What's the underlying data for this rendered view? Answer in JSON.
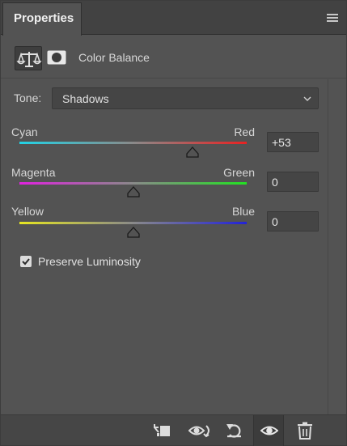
{
  "panel": {
    "tab_label": "Properties",
    "title": "Color Balance"
  },
  "tone": {
    "label": "Tone:",
    "value": "Shadows"
  },
  "sliders": [
    {
      "left_label": "Cyan",
      "right_label": "Red",
      "value": "+53",
      "left_color": "#22d3e6",
      "right_color": "#e82222",
      "position": 0.76
    },
    {
      "left_label": "Magenta",
      "right_label": "Green",
      "value": "0",
      "left_color": "#e122e0",
      "right_color": "#22e222",
      "position": 0.5
    },
    {
      "left_label": "Yellow",
      "right_label": "Blue",
      "value": "0",
      "left_color": "#e6e622",
      "right_color": "#2222d8",
      "position": 0.5
    }
  ],
  "preserve_luminosity": {
    "label": "Preserve Luminosity",
    "checked": true
  },
  "icons": {
    "tab_menu": "hamburger-menu-icon",
    "adjustment": "balance-scale-icon",
    "mask": "mask-icon",
    "clip": "clip-to-layer-icon",
    "view_previous": "view-previous-state-icon",
    "reset": "reset-icon",
    "visibility": "eye-icon",
    "delete": "trash-icon"
  }
}
